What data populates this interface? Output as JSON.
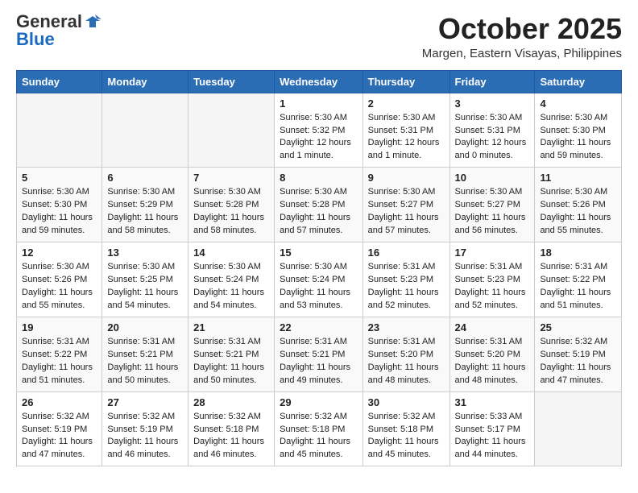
{
  "header": {
    "logo_general": "General",
    "logo_blue": "Blue",
    "month_title": "October 2025",
    "location": "Margen, Eastern Visayas, Philippines"
  },
  "weekdays": [
    "Sunday",
    "Monday",
    "Tuesday",
    "Wednesday",
    "Thursday",
    "Friday",
    "Saturday"
  ],
  "weeks": [
    [
      {
        "day": "",
        "content": ""
      },
      {
        "day": "",
        "content": ""
      },
      {
        "day": "",
        "content": ""
      },
      {
        "day": "1",
        "content": "Sunrise: 5:30 AM\nSunset: 5:32 PM\nDaylight: 12 hours\nand 1 minute."
      },
      {
        "day": "2",
        "content": "Sunrise: 5:30 AM\nSunset: 5:31 PM\nDaylight: 12 hours\nand 1 minute."
      },
      {
        "day": "3",
        "content": "Sunrise: 5:30 AM\nSunset: 5:31 PM\nDaylight: 12 hours\nand 0 minutes."
      },
      {
        "day": "4",
        "content": "Sunrise: 5:30 AM\nSunset: 5:30 PM\nDaylight: 11 hours\nand 59 minutes."
      }
    ],
    [
      {
        "day": "5",
        "content": "Sunrise: 5:30 AM\nSunset: 5:30 PM\nDaylight: 11 hours\nand 59 minutes."
      },
      {
        "day": "6",
        "content": "Sunrise: 5:30 AM\nSunset: 5:29 PM\nDaylight: 11 hours\nand 58 minutes."
      },
      {
        "day": "7",
        "content": "Sunrise: 5:30 AM\nSunset: 5:28 PM\nDaylight: 11 hours\nand 58 minutes."
      },
      {
        "day": "8",
        "content": "Sunrise: 5:30 AM\nSunset: 5:28 PM\nDaylight: 11 hours\nand 57 minutes."
      },
      {
        "day": "9",
        "content": "Sunrise: 5:30 AM\nSunset: 5:27 PM\nDaylight: 11 hours\nand 57 minutes."
      },
      {
        "day": "10",
        "content": "Sunrise: 5:30 AM\nSunset: 5:27 PM\nDaylight: 11 hours\nand 56 minutes."
      },
      {
        "day": "11",
        "content": "Sunrise: 5:30 AM\nSunset: 5:26 PM\nDaylight: 11 hours\nand 55 minutes."
      }
    ],
    [
      {
        "day": "12",
        "content": "Sunrise: 5:30 AM\nSunset: 5:26 PM\nDaylight: 11 hours\nand 55 minutes."
      },
      {
        "day": "13",
        "content": "Sunrise: 5:30 AM\nSunset: 5:25 PM\nDaylight: 11 hours\nand 54 minutes."
      },
      {
        "day": "14",
        "content": "Sunrise: 5:30 AM\nSunset: 5:24 PM\nDaylight: 11 hours\nand 54 minutes."
      },
      {
        "day": "15",
        "content": "Sunrise: 5:30 AM\nSunset: 5:24 PM\nDaylight: 11 hours\nand 53 minutes."
      },
      {
        "day": "16",
        "content": "Sunrise: 5:31 AM\nSunset: 5:23 PM\nDaylight: 11 hours\nand 52 minutes."
      },
      {
        "day": "17",
        "content": "Sunrise: 5:31 AM\nSunset: 5:23 PM\nDaylight: 11 hours\nand 52 minutes."
      },
      {
        "day": "18",
        "content": "Sunrise: 5:31 AM\nSunset: 5:22 PM\nDaylight: 11 hours\nand 51 minutes."
      }
    ],
    [
      {
        "day": "19",
        "content": "Sunrise: 5:31 AM\nSunset: 5:22 PM\nDaylight: 11 hours\nand 51 minutes."
      },
      {
        "day": "20",
        "content": "Sunrise: 5:31 AM\nSunset: 5:21 PM\nDaylight: 11 hours\nand 50 minutes."
      },
      {
        "day": "21",
        "content": "Sunrise: 5:31 AM\nSunset: 5:21 PM\nDaylight: 11 hours\nand 50 minutes."
      },
      {
        "day": "22",
        "content": "Sunrise: 5:31 AM\nSunset: 5:21 PM\nDaylight: 11 hours\nand 49 minutes."
      },
      {
        "day": "23",
        "content": "Sunrise: 5:31 AM\nSunset: 5:20 PM\nDaylight: 11 hours\nand 48 minutes."
      },
      {
        "day": "24",
        "content": "Sunrise: 5:31 AM\nSunset: 5:20 PM\nDaylight: 11 hours\nand 48 minutes."
      },
      {
        "day": "25",
        "content": "Sunrise: 5:32 AM\nSunset: 5:19 PM\nDaylight: 11 hours\nand 47 minutes."
      }
    ],
    [
      {
        "day": "26",
        "content": "Sunrise: 5:32 AM\nSunset: 5:19 PM\nDaylight: 11 hours\nand 47 minutes."
      },
      {
        "day": "27",
        "content": "Sunrise: 5:32 AM\nSunset: 5:19 PM\nDaylight: 11 hours\nand 46 minutes."
      },
      {
        "day": "28",
        "content": "Sunrise: 5:32 AM\nSunset: 5:18 PM\nDaylight: 11 hours\nand 46 minutes."
      },
      {
        "day": "29",
        "content": "Sunrise: 5:32 AM\nSunset: 5:18 PM\nDaylight: 11 hours\nand 45 minutes."
      },
      {
        "day": "30",
        "content": "Sunrise: 5:32 AM\nSunset: 5:18 PM\nDaylight: 11 hours\nand 45 minutes."
      },
      {
        "day": "31",
        "content": "Sunrise: 5:33 AM\nSunset: 5:17 PM\nDaylight: 11 hours\nand 44 minutes."
      },
      {
        "day": "",
        "content": ""
      }
    ]
  ]
}
